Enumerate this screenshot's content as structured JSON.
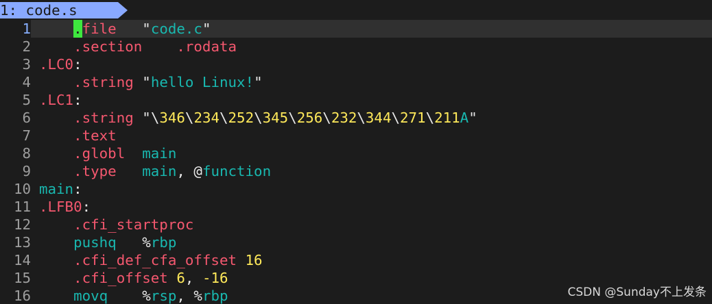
{
  "tab": {
    "label": "1: code.s"
  },
  "lines": [
    {
      "num": "1",
      "current": true,
      "tokens": [
        {
          "t": "    ",
          "c": "plain"
        },
        {
          "t": ".",
          "c": "cursor"
        },
        {
          "t": "file",
          "c": "directive"
        },
        {
          "t": "   ",
          "c": "plain"
        },
        {
          "t": "\"",
          "c": "quote"
        },
        {
          "t": "code.c",
          "c": "str"
        },
        {
          "t": "\"",
          "c": "quote"
        }
      ]
    },
    {
      "num": "2",
      "tokens": [
        {
          "t": "    ",
          "c": "plain"
        },
        {
          "t": ".section",
          "c": "directive"
        },
        {
          "t": "    ",
          "c": "plain"
        },
        {
          "t": ".rodata",
          "c": "directive"
        }
      ]
    },
    {
      "num": "3",
      "tokens": [
        {
          "t": ".LC0",
          "c": "label"
        },
        {
          "t": ":",
          "c": "punct"
        }
      ]
    },
    {
      "num": "4",
      "tokens": [
        {
          "t": "    ",
          "c": "plain"
        },
        {
          "t": ".string",
          "c": "directive"
        },
        {
          "t": " ",
          "c": "plain"
        },
        {
          "t": "\"",
          "c": "quote"
        },
        {
          "t": "hello Linux!",
          "c": "str"
        },
        {
          "t": "\"",
          "c": "quote"
        }
      ]
    },
    {
      "num": "5",
      "tokens": [
        {
          "t": ".LC1",
          "c": "label"
        },
        {
          "t": ":",
          "c": "punct"
        }
      ]
    },
    {
      "num": "6",
      "tokens": [
        {
          "t": "    ",
          "c": "plain"
        },
        {
          "t": ".string",
          "c": "directive"
        },
        {
          "t": " ",
          "c": "plain"
        },
        {
          "t": "\"",
          "c": "quote"
        },
        {
          "t": "\\",
          "c": "quote"
        },
        {
          "t": "346",
          "c": "escape"
        },
        {
          "t": "\\",
          "c": "quote"
        },
        {
          "t": "234",
          "c": "escape"
        },
        {
          "t": "\\",
          "c": "quote"
        },
        {
          "t": "252",
          "c": "escape"
        },
        {
          "t": "\\",
          "c": "quote"
        },
        {
          "t": "345",
          "c": "escape"
        },
        {
          "t": "\\",
          "c": "quote"
        },
        {
          "t": "256",
          "c": "escape"
        },
        {
          "t": "\\",
          "c": "quote"
        },
        {
          "t": "232",
          "c": "escape"
        },
        {
          "t": "\\",
          "c": "quote"
        },
        {
          "t": "344",
          "c": "escape"
        },
        {
          "t": "\\",
          "c": "quote"
        },
        {
          "t": "271",
          "c": "escape"
        },
        {
          "t": "\\",
          "c": "quote"
        },
        {
          "t": "211",
          "c": "escape"
        },
        {
          "t": "A",
          "c": "str"
        },
        {
          "t": "\"",
          "c": "quote"
        }
      ]
    },
    {
      "num": "7",
      "tokens": [
        {
          "t": "    ",
          "c": "plain"
        },
        {
          "t": ".text",
          "c": "directive"
        }
      ]
    },
    {
      "num": "8",
      "tokens": [
        {
          "t": "    ",
          "c": "plain"
        },
        {
          "t": ".globl",
          "c": "directive"
        },
        {
          "t": "  ",
          "c": "plain"
        },
        {
          "t": "main",
          "c": "ident"
        }
      ]
    },
    {
      "num": "9",
      "tokens": [
        {
          "t": "    ",
          "c": "plain"
        },
        {
          "t": ".type",
          "c": "directive"
        },
        {
          "t": "   ",
          "c": "plain"
        },
        {
          "t": "main",
          "c": "ident"
        },
        {
          "t": ", ",
          "c": "op"
        },
        {
          "t": "@",
          "c": "op"
        },
        {
          "t": "function",
          "c": "ident"
        }
      ]
    },
    {
      "num": "10",
      "tokens": [
        {
          "t": "main",
          "c": "ident"
        },
        {
          "t": ":",
          "c": "punct"
        }
      ]
    },
    {
      "num": "11",
      "tokens": [
        {
          "t": ".LFB0",
          "c": "label"
        },
        {
          "t": ":",
          "c": "punct"
        }
      ]
    },
    {
      "num": "12",
      "tokens": [
        {
          "t": "    ",
          "c": "plain"
        },
        {
          "t": ".cfi_startproc",
          "c": "directive"
        }
      ]
    },
    {
      "num": "13",
      "tokens": [
        {
          "t": "    ",
          "c": "plain"
        },
        {
          "t": "pushq",
          "c": "ident"
        },
        {
          "t": "   ",
          "c": "plain"
        },
        {
          "t": "%",
          "c": "op"
        },
        {
          "t": "rbp",
          "c": "ident"
        }
      ]
    },
    {
      "num": "14",
      "tokens": [
        {
          "t": "    ",
          "c": "plain"
        },
        {
          "t": ".cfi_def_cfa_offset",
          "c": "directive"
        },
        {
          "t": " ",
          "c": "plain"
        },
        {
          "t": "16",
          "c": "num"
        }
      ]
    },
    {
      "num": "15",
      "tokens": [
        {
          "t": "    ",
          "c": "plain"
        },
        {
          "t": ".cfi_offset",
          "c": "directive"
        },
        {
          "t": " ",
          "c": "plain"
        },
        {
          "t": "6",
          "c": "num"
        },
        {
          "t": ", ",
          "c": "op"
        },
        {
          "t": "-16",
          "c": "num"
        }
      ]
    },
    {
      "num": "16",
      "tokens": [
        {
          "t": "    ",
          "c": "plain"
        },
        {
          "t": "movq",
          "c": "ident"
        },
        {
          "t": "    ",
          "c": "plain"
        },
        {
          "t": "%",
          "c": "op"
        },
        {
          "t": "rsp",
          "c": "ident"
        },
        {
          "t": ", ",
          "c": "op"
        },
        {
          "t": "%",
          "c": "op"
        },
        {
          "t": "rbp",
          "c": "ident"
        }
      ]
    }
  ],
  "watermark": "CSDN @Sunday不上发条",
  "colors": {
    "background": "#1c1c1c",
    "tab": "#89a9ff",
    "directive": "#f5586f",
    "string": "#19b8b0",
    "number": "#ffe95a",
    "cursor": "#3ee73e",
    "line_number": "#9e9e9e",
    "current_line_number": "#87afff"
  }
}
